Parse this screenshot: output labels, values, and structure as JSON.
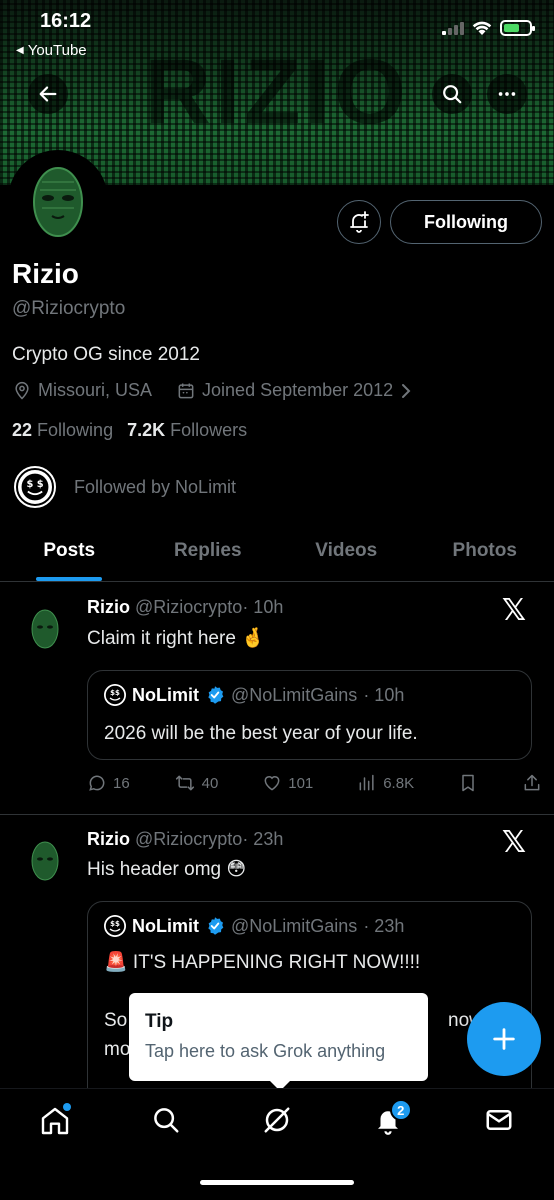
{
  "status_bar": {
    "time": "16:12",
    "back_app": "YouTube"
  },
  "banner": {
    "title": "RIZIO"
  },
  "profile": {
    "name": "Rizio",
    "handle": "@Riziocrypto",
    "bio": "Crypto OG since 2012",
    "location": "Missouri, USA",
    "joined": "Joined September 2012",
    "following_count": "22",
    "following_label": "Following",
    "followers_count": "7.2K",
    "followers_label": "Followers",
    "followed_by": "Followed by NoLimit",
    "follow_button": "Following"
  },
  "tabs": [
    {
      "label": "Posts",
      "active": true
    },
    {
      "label": "Replies",
      "active": false
    },
    {
      "label": "Videos",
      "active": false
    },
    {
      "label": "Photos",
      "active": false
    }
  ],
  "posts": [
    {
      "author": "Rizio",
      "handle": "@Riziocrypto",
      "time": "· 10h",
      "text": "Claim it right here 🤞",
      "quote": {
        "author": "NoLimit",
        "handle": "@NoLimitGains",
        "time": "· 10h",
        "text": "2026 will be the best year of your life."
      },
      "replies": "16",
      "reposts": "40",
      "likes": "101",
      "views": "6.8K"
    },
    {
      "author": "Rizio",
      "handle": "@Riziocrypto",
      "time": "· 23h",
      "text": "His header omg 😳",
      "quote": {
        "author": "NoLimit",
        "handle": "@NoLimitGains",
        "time": "· 23h",
        "text": "🚨 IT'S HAPPENING RIGHT NOW!!!!",
        "text_line2_left": "So",
        "text_line2_right": "now",
        "text_line3_left": "mo"
      }
    }
  ],
  "tooltip": {
    "title": "Tip",
    "text": "Tap here to ask Grok anything"
  },
  "notifications_badge": "2",
  "colors": {
    "accent": "#1d9bf0",
    "background": "#000000",
    "muted": "#71767b"
  }
}
